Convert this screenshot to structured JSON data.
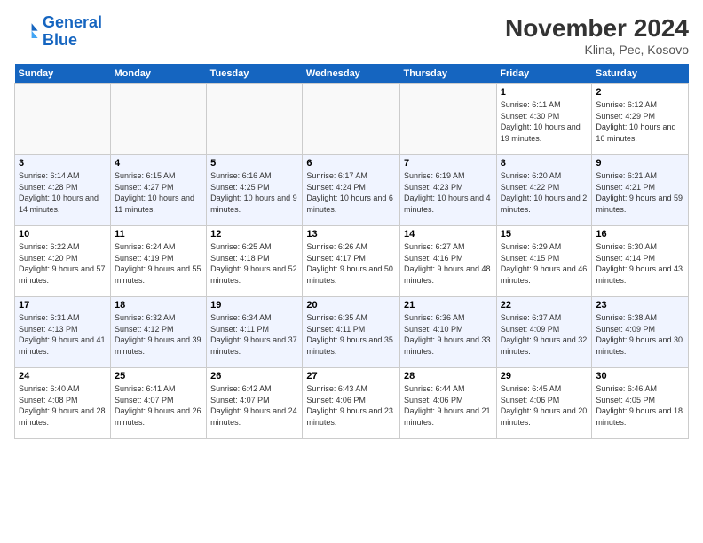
{
  "logo": {
    "line1": "General",
    "line2": "Blue"
  },
  "title": "November 2024",
  "subtitle": "Klina, Pec, Kosovo",
  "headers": [
    "Sunday",
    "Monday",
    "Tuesday",
    "Wednesday",
    "Thursday",
    "Friday",
    "Saturday"
  ],
  "weeks": [
    [
      {
        "day": "",
        "detail": ""
      },
      {
        "day": "",
        "detail": ""
      },
      {
        "day": "",
        "detail": ""
      },
      {
        "day": "",
        "detail": ""
      },
      {
        "day": "",
        "detail": ""
      },
      {
        "day": "1",
        "detail": "Sunrise: 6:11 AM\nSunset: 4:30 PM\nDaylight: 10 hours and 19 minutes."
      },
      {
        "day": "2",
        "detail": "Sunrise: 6:12 AM\nSunset: 4:29 PM\nDaylight: 10 hours and 16 minutes."
      }
    ],
    [
      {
        "day": "3",
        "detail": "Sunrise: 6:14 AM\nSunset: 4:28 PM\nDaylight: 10 hours and 14 minutes."
      },
      {
        "day": "4",
        "detail": "Sunrise: 6:15 AM\nSunset: 4:27 PM\nDaylight: 10 hours and 11 minutes."
      },
      {
        "day": "5",
        "detail": "Sunrise: 6:16 AM\nSunset: 4:25 PM\nDaylight: 10 hours and 9 minutes."
      },
      {
        "day": "6",
        "detail": "Sunrise: 6:17 AM\nSunset: 4:24 PM\nDaylight: 10 hours and 6 minutes."
      },
      {
        "day": "7",
        "detail": "Sunrise: 6:19 AM\nSunset: 4:23 PM\nDaylight: 10 hours and 4 minutes."
      },
      {
        "day": "8",
        "detail": "Sunrise: 6:20 AM\nSunset: 4:22 PM\nDaylight: 10 hours and 2 minutes."
      },
      {
        "day": "9",
        "detail": "Sunrise: 6:21 AM\nSunset: 4:21 PM\nDaylight: 9 hours and 59 minutes."
      }
    ],
    [
      {
        "day": "10",
        "detail": "Sunrise: 6:22 AM\nSunset: 4:20 PM\nDaylight: 9 hours and 57 minutes."
      },
      {
        "day": "11",
        "detail": "Sunrise: 6:24 AM\nSunset: 4:19 PM\nDaylight: 9 hours and 55 minutes."
      },
      {
        "day": "12",
        "detail": "Sunrise: 6:25 AM\nSunset: 4:18 PM\nDaylight: 9 hours and 52 minutes."
      },
      {
        "day": "13",
        "detail": "Sunrise: 6:26 AM\nSunset: 4:17 PM\nDaylight: 9 hours and 50 minutes."
      },
      {
        "day": "14",
        "detail": "Sunrise: 6:27 AM\nSunset: 4:16 PM\nDaylight: 9 hours and 48 minutes."
      },
      {
        "day": "15",
        "detail": "Sunrise: 6:29 AM\nSunset: 4:15 PM\nDaylight: 9 hours and 46 minutes."
      },
      {
        "day": "16",
        "detail": "Sunrise: 6:30 AM\nSunset: 4:14 PM\nDaylight: 9 hours and 43 minutes."
      }
    ],
    [
      {
        "day": "17",
        "detail": "Sunrise: 6:31 AM\nSunset: 4:13 PM\nDaylight: 9 hours and 41 minutes."
      },
      {
        "day": "18",
        "detail": "Sunrise: 6:32 AM\nSunset: 4:12 PM\nDaylight: 9 hours and 39 minutes."
      },
      {
        "day": "19",
        "detail": "Sunrise: 6:34 AM\nSunset: 4:11 PM\nDaylight: 9 hours and 37 minutes."
      },
      {
        "day": "20",
        "detail": "Sunrise: 6:35 AM\nSunset: 4:11 PM\nDaylight: 9 hours and 35 minutes."
      },
      {
        "day": "21",
        "detail": "Sunrise: 6:36 AM\nSunset: 4:10 PM\nDaylight: 9 hours and 33 minutes."
      },
      {
        "day": "22",
        "detail": "Sunrise: 6:37 AM\nSunset: 4:09 PM\nDaylight: 9 hours and 32 minutes."
      },
      {
        "day": "23",
        "detail": "Sunrise: 6:38 AM\nSunset: 4:09 PM\nDaylight: 9 hours and 30 minutes."
      }
    ],
    [
      {
        "day": "24",
        "detail": "Sunrise: 6:40 AM\nSunset: 4:08 PM\nDaylight: 9 hours and 28 minutes."
      },
      {
        "day": "25",
        "detail": "Sunrise: 6:41 AM\nSunset: 4:07 PM\nDaylight: 9 hours and 26 minutes."
      },
      {
        "day": "26",
        "detail": "Sunrise: 6:42 AM\nSunset: 4:07 PM\nDaylight: 9 hours and 24 minutes."
      },
      {
        "day": "27",
        "detail": "Sunrise: 6:43 AM\nSunset: 4:06 PM\nDaylight: 9 hours and 23 minutes."
      },
      {
        "day": "28",
        "detail": "Sunrise: 6:44 AM\nSunset: 4:06 PM\nDaylight: 9 hours and 21 minutes."
      },
      {
        "day": "29",
        "detail": "Sunrise: 6:45 AM\nSunset: 4:06 PM\nDaylight: 9 hours and 20 minutes."
      },
      {
        "day": "30",
        "detail": "Sunrise: 6:46 AM\nSunset: 4:05 PM\nDaylight: 9 hours and 18 minutes."
      }
    ]
  ]
}
